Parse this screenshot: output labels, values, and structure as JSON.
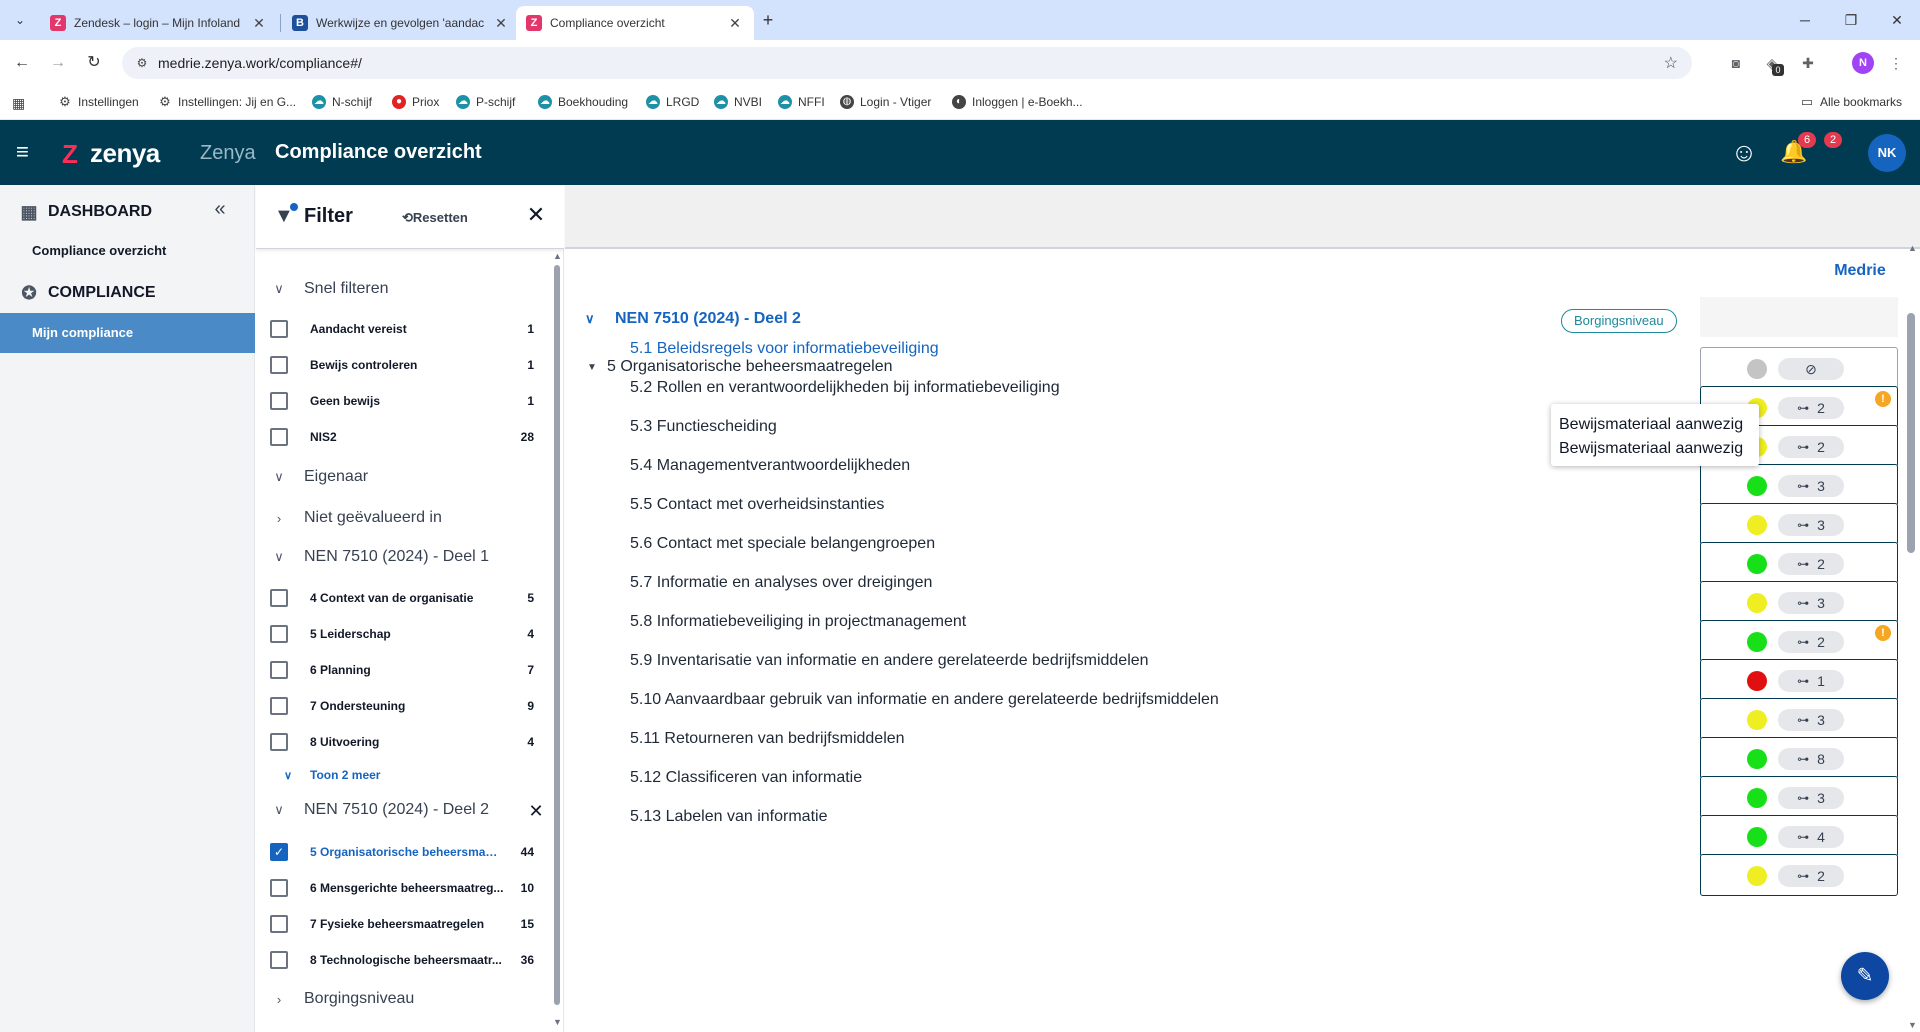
{
  "browser": {
    "tabs": [
      {
        "title": "Zendesk – login – Mijn Infoland",
        "favicon": "zendesk-icon"
      },
      {
        "title": "Werkwijze en gevolgen 'aandac",
        "favicon": "b-icon"
      },
      {
        "title": "Compliance overzicht",
        "favicon": "zenya-icon"
      }
    ],
    "url": "medrie.zenya.work/compliance#/",
    "profile_initial": "N",
    "extension_badge": "0",
    "bookmarks": [
      {
        "label": "Instellingen",
        "icon": "gear-icon"
      },
      {
        "label": "Instellingen: Jij en G...",
        "icon": "gear-icon"
      },
      {
        "label": "N-schijf",
        "icon": "cloud-icon"
      },
      {
        "label": "Priox",
        "icon": "priox-icon"
      },
      {
        "label": "P-schijf",
        "icon": "cloud-icon"
      },
      {
        "label": "Boekhouding",
        "icon": "cloud-icon"
      },
      {
        "label": "LRGD",
        "icon": "cloud-icon"
      },
      {
        "label": "NVBI",
        "icon": "cloud-icon"
      },
      {
        "label": "NFFI",
        "icon": "cloud-icon"
      },
      {
        "label": "Login - Vtiger",
        "icon": "globe-icon"
      },
      {
        "label": "Inloggen | e-Boekh...",
        "icon": "eboekh-icon"
      }
    ],
    "all_bookmarks": "Alle bookmarks"
  },
  "header": {
    "logo_text": "zenya",
    "app_name": "Zenya",
    "page_title": "Compliance overzicht",
    "notif_badges": [
      "6",
      "2"
    ],
    "user_initials": "NK"
  },
  "sidebar": {
    "dashboard_label": "DASHBOARD",
    "dashboard_item": "Compliance overzicht",
    "compliance_label": "COMPLIANCE",
    "compliance_item": "Mijn compliance"
  },
  "filter": {
    "title": "Filter",
    "reset_label": "Resetten",
    "snel_filteren": "Snel filteren",
    "quick": [
      {
        "label": "Aandacht vereist",
        "count": "1"
      },
      {
        "label": "Bewijs controleren",
        "count": "1"
      },
      {
        "label": "Geen bewijs",
        "count": "1"
      },
      {
        "label": "NIS2",
        "count": "28"
      }
    ],
    "eigenaar": "Eigenaar",
    "niet_geevalueerd": "Niet geëvalueerd in",
    "deel1_title": "NEN 7510 (2024) - Deel 1",
    "deel1": [
      {
        "label": "4 Context van de organisatie",
        "count": "5"
      },
      {
        "label": "5 Leiderschap",
        "count": "4"
      },
      {
        "label": "6 Planning",
        "count": "7"
      },
      {
        "label": "7 Ondersteuning",
        "count": "9"
      },
      {
        "label": "8 Uitvoering",
        "count": "4"
      }
    ],
    "show_more": "Toon 2 meer",
    "deel2_title": "NEN 7510 (2024) - Deel 2",
    "deel2": [
      {
        "label": "5 Organisatorische beheersmaat...",
        "count": "44",
        "checked": true
      },
      {
        "label": "6 Mensgerichte beheersmaatreg...",
        "count": "10",
        "checked": false
      },
      {
        "label": "7 Fysieke beheersmaatregelen",
        "count": "15",
        "checked": false
      },
      {
        "label": "8 Technologische beheersmaatr...",
        "count": "36",
        "checked": false
      }
    ],
    "borgingsniveau": "Borgingsniveau"
  },
  "main": {
    "column_header": "Medrie",
    "standard_title": "NEN 7510 (2024) - Deel 2",
    "borg_pill": "Borgingsniveau",
    "category_title": "5 Organisatorische beheersmaatregelen",
    "tooltip_lines": [
      "Bewijsmateriaal aanwezig",
      "Bewijsmateriaal aanwezig"
    ],
    "status_colors": {
      "green": "#18e018",
      "yellow": "#eeee22",
      "red": "#e01010",
      "grey": "#c4c4c4"
    },
    "rows": [
      {
        "label": "5.1 Beleidsregels voor informatiebeveiliging",
        "status": "yellow",
        "count": "2",
        "warning": true,
        "link": true
      },
      {
        "label": "5.2 Rollen en verantwoordelijkheden bij informatiebeveiliging",
        "status": "yellow",
        "count": "2",
        "warning": false,
        "link": false
      },
      {
        "label": "5.3 Functiescheiding",
        "status": "green",
        "count": "3",
        "warning": false,
        "link": false
      },
      {
        "label": "5.4 Managementverantwoordelijkheden",
        "status": "yellow",
        "count": "3",
        "warning": false,
        "link": false
      },
      {
        "label": "5.5 Contact met overheidsinstanties",
        "status": "green",
        "count": "2",
        "warning": false,
        "link": false
      },
      {
        "label": "5.6 Contact met speciale belangengroepen",
        "status": "yellow",
        "count": "3",
        "warning": false,
        "link": false
      },
      {
        "label": "5.7 Informatie en analyses over dreigingen",
        "status": "green",
        "count": "2",
        "warning": true,
        "link": false
      },
      {
        "label": "5.8 Informatiebeveiliging in projectmanagement",
        "status": "red",
        "count": "1",
        "warning": false,
        "link": false
      },
      {
        "label": "5.9 Inventarisatie van informatie en andere gerelateerde bedrijfsmiddelen",
        "status": "yellow",
        "count": "3",
        "warning": false,
        "link": false
      },
      {
        "label": "5.10 Aanvaardbaar gebruik van informatie en andere gerelateerde bedrijfsmiddelen",
        "status": "green",
        "count": "8",
        "warning": false,
        "link": false
      },
      {
        "label": "5.11 Retourneren van bedrijfsmiddelen",
        "status": "green",
        "count": "3",
        "warning": false,
        "link": false
      },
      {
        "label": "5.12 Classificeren van informatie",
        "status": "green",
        "count": "4",
        "warning": false,
        "link": false
      },
      {
        "label": "5.13 Labelen van informatie",
        "status": "yellow",
        "count": "2",
        "warning": false,
        "link": false
      }
    ]
  }
}
